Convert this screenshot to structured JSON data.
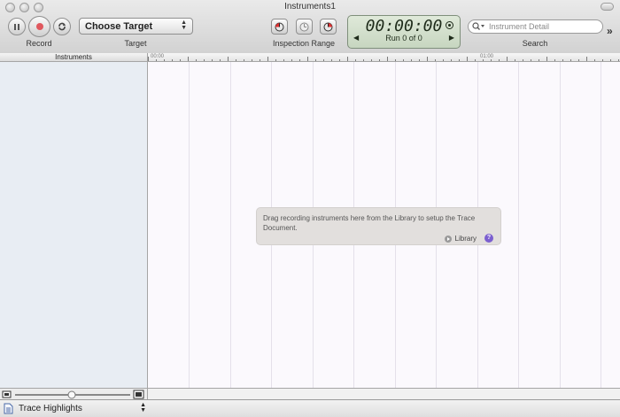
{
  "window": {
    "title": "Instruments1"
  },
  "toolbar": {
    "record_label": "Record",
    "target_popup": "Choose Target",
    "target_label": "Target",
    "inspection_label": "Inspection Range",
    "time_display": "00:00:00",
    "run_text": "Run 0 of 0",
    "search_placeholder": "Instrument Detail",
    "search_label": "Search",
    "overflow_glyph": "»"
  },
  "instruments_header": "Instruments",
  "ruler": {
    "labels": [
      "00:00",
      "01:00"
    ]
  },
  "drop_hint": {
    "message": "Drag recording instruments here from the Library to setup the Trace Document.",
    "library_label": "Library",
    "help_glyph": "?"
  },
  "detail": {
    "view_popup": "Trace Highlights"
  },
  "colors": {
    "lcd": "#d3e0cd",
    "help": "#7b5fcf",
    "record": "#e0585e",
    "sidebar": "#e8edf3"
  },
  "icons": [
    "pause-icon",
    "record-icon",
    "loop-icon",
    "inspection-start-icon",
    "inspection-clear-icon",
    "inspection-end-icon",
    "clock-icon",
    "search-icon",
    "library-icon",
    "help-icon",
    "document-icon"
  ]
}
